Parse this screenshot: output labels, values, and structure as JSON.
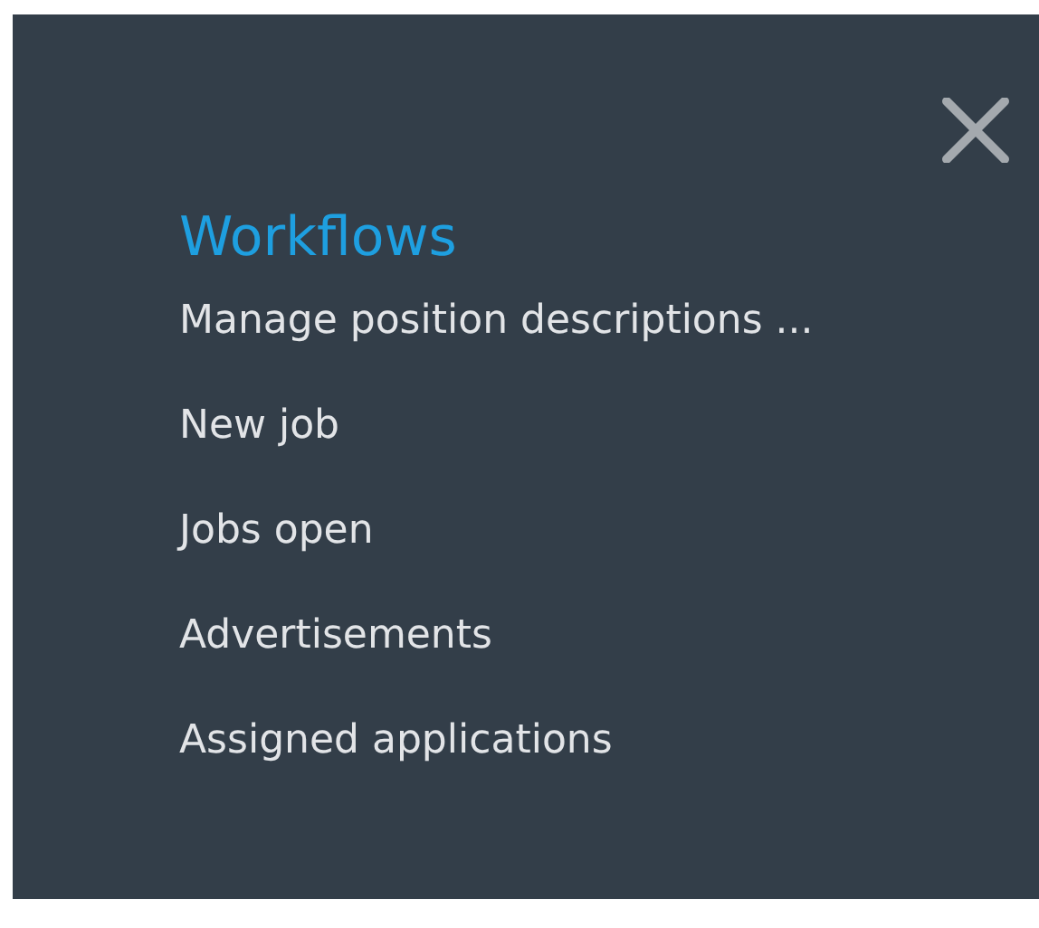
{
  "heading": "Workflows",
  "items": [
    {
      "label": "Manage position descriptions ..."
    },
    {
      "label": "New job"
    },
    {
      "label": "Jobs open"
    },
    {
      "label": "Advertisements"
    },
    {
      "label": "Assigned applications"
    }
  ]
}
